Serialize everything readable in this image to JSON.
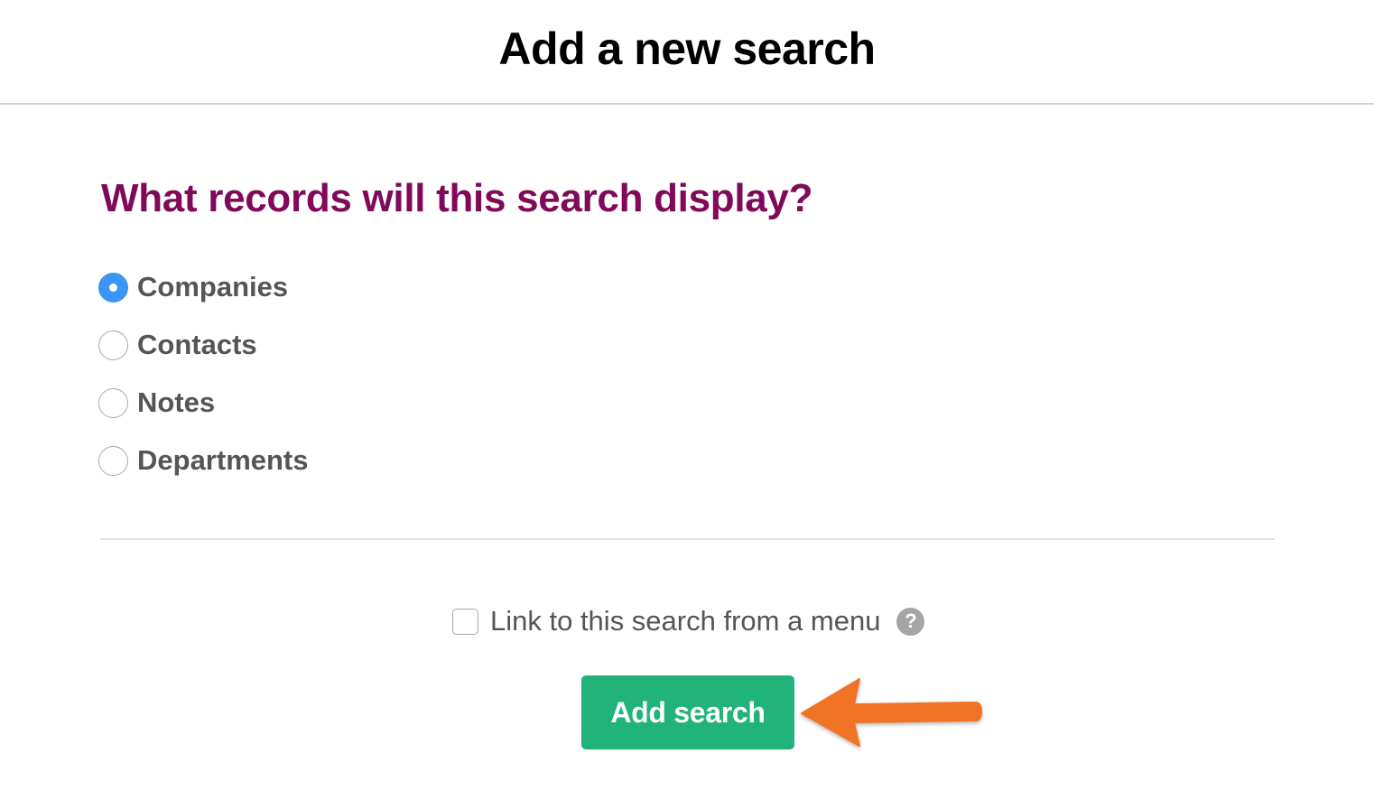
{
  "header": {
    "title": "Add a new search"
  },
  "question": {
    "text": "What records will this search display?"
  },
  "record_types": [
    {
      "label": "Companies",
      "selected": true
    },
    {
      "label": "Contacts",
      "selected": false
    },
    {
      "label": "Notes",
      "selected": false
    },
    {
      "label": "Departments",
      "selected": false
    }
  ],
  "menu_link": {
    "label": "Link to this search from a menu",
    "checked": false,
    "help_icon": "question-circle-icon",
    "help_glyph": "?"
  },
  "actions": {
    "add_label": "Add search"
  },
  "colors": {
    "title": "#000000",
    "question": "#800a5a",
    "radio_selected": "#3b95f5",
    "add_button": "#21b37a",
    "arrow": "#f07328"
  },
  "annotation": {
    "icon": "arrow-left-icon"
  }
}
